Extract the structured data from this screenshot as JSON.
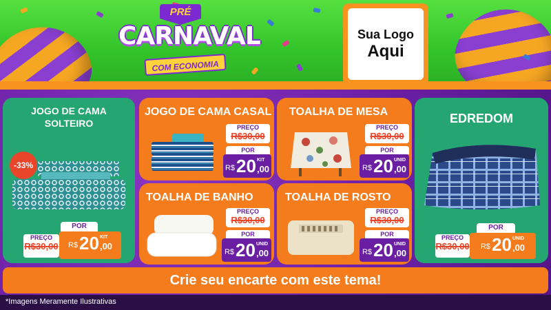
{
  "header": {
    "brand_pre": "PRÉ",
    "brand_main": "CARNAVAL",
    "brand_sub": "COM ECONOMIA",
    "logo_line1": "Sua Logo",
    "logo_line2": "Aqui"
  },
  "products": [
    {
      "title_1": "JOGO DE CAMA",
      "title_2": "SOLTEIRO",
      "badge": "-33%",
      "preco_label": "PREÇO",
      "old_price": "R$30,00",
      "por_label": "POR",
      "currency": "R$",
      "price_int": "20",
      "price_cents": ",00",
      "unit": "KIT"
    },
    {
      "title": "JOGO DE CAMA CASAL",
      "preco_label": "PREÇO",
      "old_price": "R$30,00",
      "por_label": "POR",
      "currency": "R$",
      "price_int": "20",
      "price_cents": ",00",
      "unit": "KIT"
    },
    {
      "title": "TOALHA DE MESA",
      "preco_label": "PREÇO",
      "old_price": "R$30,00",
      "por_label": "POR",
      "currency": "R$",
      "price_int": "20",
      "price_cents": ",00",
      "unit": "UNID"
    },
    {
      "title": "EDREDOM",
      "preco_label": "PREÇO",
      "old_price": "R$30,00",
      "por_label": "POR",
      "currency": "R$",
      "price_int": "20",
      "price_cents": ",00",
      "unit": "UNID"
    },
    {
      "title": "TOALHA DE BANHO",
      "preco_label": "PREÇO",
      "old_price": "R$30,00",
      "por_label": "POR",
      "currency": "R$",
      "price_int": "20",
      "price_cents": ",00",
      "unit": "UNID"
    },
    {
      "title": "TOALHA DE ROSTO",
      "preco_label": "PREÇO",
      "old_price": "R$30,00",
      "por_label": "POR",
      "currency": "R$",
      "price_int": "20",
      "price_cents": ",00",
      "unit": "UNID"
    }
  ],
  "cta": "Crie seu encarte com este tema!",
  "footer_note": "*Imagens Meramente Ilustrativas",
  "colors": {
    "green": "#24a572",
    "orange": "#f47c1d",
    "purple": "#6a1fa3",
    "red": "#e8452a"
  }
}
